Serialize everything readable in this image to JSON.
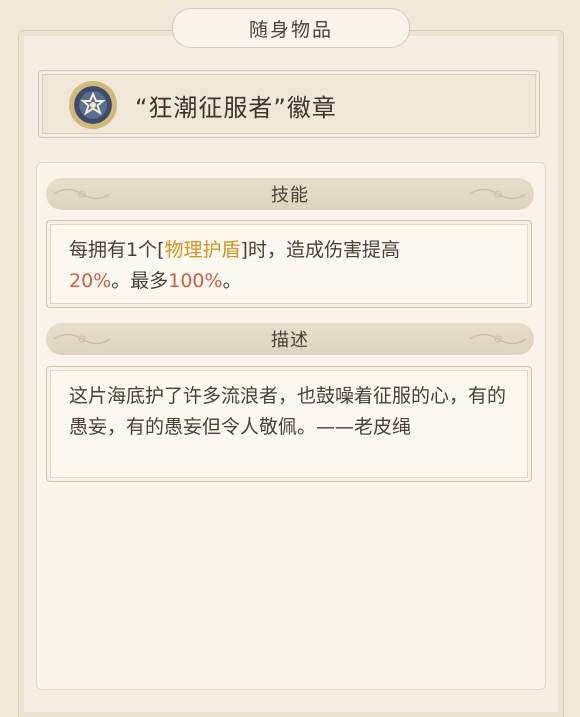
{
  "header": {
    "title": "随身物品"
  },
  "item": {
    "name": "“狂潮征服者”徽章",
    "icon": "star-badge-icon"
  },
  "skill": {
    "header": "技能",
    "parts": [
      "每拥有1个[",
      "物理护盾",
      "]时，造成伤害提高",
      "20%",
      "。最多",
      "100%",
      "。"
    ]
  },
  "description": {
    "header": "描述",
    "text": "这片海底护了许多流浪者，也鼓噪着征服的心，有的愚妄，有的愚妄但令人敬佩。——老皮绳"
  },
  "colors": {
    "highlight_gold": "#d8931e",
    "highlight_red": "#cf5f47"
  }
}
